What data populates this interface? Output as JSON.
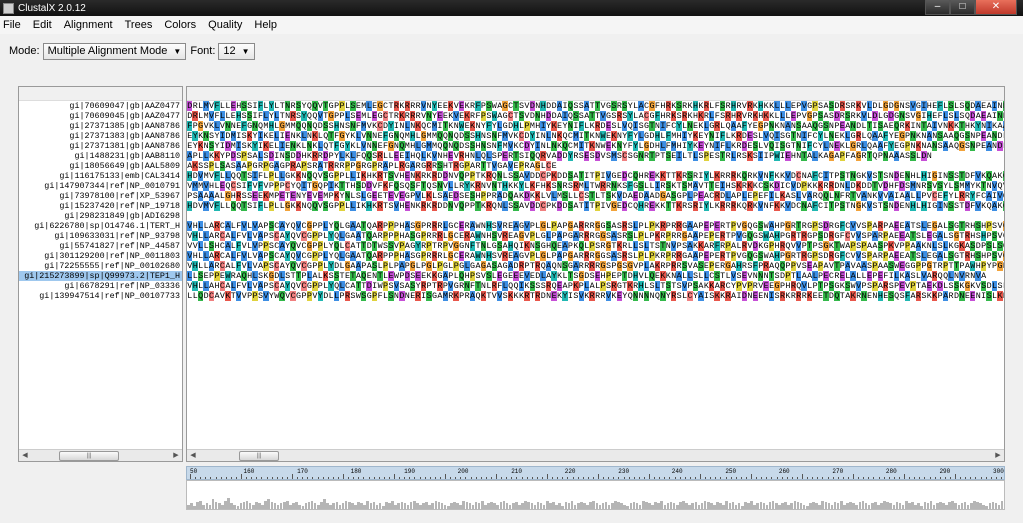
{
  "window": {
    "title": "ClustalX 2.0.12"
  },
  "menu": [
    "File",
    "Edit",
    "Alignment",
    "Trees",
    "Colors",
    "Quality",
    "Help"
  ],
  "mode": {
    "label": "Mode:",
    "value": "Multiple Alignment Mode",
    "font_label": "Font:",
    "font_value": "12"
  },
  "names": [
    "gi|70609047|gb|AAZ0477",
    "gi|70609045|gb|AAZ0477",
    "gi|27371385|gb|AAN8786",
    "gi|27371383|gb|AAN8786",
    "gi|27371381|gb|AAN8786",
    "gi|1488231|gb|AAB8110",
    "gi|18056649|gb|AAL5809",
    "gi|116175133|emb|CAL3414",
    "gi|147907344|ref|NP_0010791",
    "gi|73978100|ref|XP_53967",
    "gi|15237420|ref|NP_19718",
    "gi|298231849|gb|ADI6298",
    "gi|6226780|sp|O14746.1|TERT_H",
    "gi|109633031|ref|NP_93798",
    "gi|55741827|ref|NP_44587",
    "gi|301129200|ref|NP_0011803",
    "gi|72255555|ref|NP_00102680",
    "gi|215273899|sp|Q99973.2|TEP1_H",
    "gi|6678291|ref|NP_03336",
    "gi|139947514|ref|NP_00107733"
  ],
  "selected_index": 17,
  "sequences": [
    "DRLMVFLLEHSSIFLYLTNRSYQQVTGPPLSEMLEGCTRKRRRVNYEEKVEKRFPSWAGCTSVDNHDDAIQSSATTVGSRSYLACGFHRKSRKHKRLFSRHRVRKHKKLLLEPVGPSASDRSRKVLDLGDGNSVGIHEFLSLSQDAEAINNEKSCSN",
    "DRLMVFLLEHSSIFLYLTNRSYQQVTGPPLSEMLEGCTRKRRRVNYEEKVEKRFPSWAGCTSVDNHDDAIQSSATTVGSRSYLACGFHRKSRKHKRLFSRHRVRKHKKLLLEPVGPSASDRSRKVLDLGDGNSVGIHEFLSLSQDAEAINNEKSCSN",
    "FPGVKLVNNEFGNQMHLGMMQQNQDSSHNSNFMVKCDYINLNKQCMITKNWEKNYFYLGDHLPMHIYKEYNIFLKRDESLVQISGTNIFCYLNEKLGRLQAAFYEGPNKNANSAAQGSNPEANDLTISAEQRKINTAIVNKKTHKYNIKAADESY",
    "EYKNSYIDMISKYIKELIENKLNKLQTFGYKLVNNEFGNQMHLGMMQQNQDSSHNSNFMVKCDYINLNKQCMITKNWEKNYFYLGDHLFMHIYKEYNIFLKRDESLVQISGTNIFCYLNEKLGRLQAAFYEGPNKNANSAAQGSNPEANDLLS",
    "EYKNSYIDMISKYIKELIENKLNKLQTFGYKLVNNEFGNQMHLGMMQQNQDSSHNSNFMVKCDYINLNKQCMITKNWEKNYFYLGDHLFMHIYKEYNIFLKRDESLVQISGTNIFCYLNEKLGRLQAAFYEGPNKNANSAAQGSNPEANDLLS",
    "APLLKKYPDSPSALSDINSDDHKRRDPYLKLFQQSRLLEEIHQLKVNHEVRHNLQLSPERTSIQQRVADDYRSESDVSMSCSGNRTPTSEILTLSPESTRLRSKSIIPWIEHNTALKAGAPFAGRTQPNAAASSLDN",
    "AKSSPLSASAAPGRPGAGPRAPSRATRRRPPGRGPRAPLRGARGRRSHTRGPARTTVGAVEPRAGLCE",
    "HDVMVFLLQQTSIFLPLLGKKNQQVSGPPLLIKHKRTSVHENKRKRDDNVQPPTKRQNLSSAVDDCPKDDSATITPIVGEDCQHREKKTTKRSRIYLKRRRKQRKVNFKKVDCNAFCITPSTNGKVSTSNDENHLHIGINSSTDFVKQAKQR",
    "VMMVHLEQCSIFVFVPPPCYQITGQPIKTTHSDDVFKFQSQSFTQSNVLLRYKRNVNTHKKYLKFHKSNRSRMLTWRRNKSFGSLLIRSKTSMAVTTEIHSKRKKCSKDICVDPKKKRRDNLDKDDTVDHFDSMNRSVSYLSMMYKTNVQVK",
    "PSAAAALGHRSSEEKMPETENYEVEMPKYNLSLGEETEVEGPVLKLSAEDSESHPPRADQAKDKKLVLMSLLCSTLTSKVDAEDAADGASGPLPEACRDLAPLEPEFILKASLVARQQLNFRTVANKVVAIAALLPVCEFYLRRYFCAIVQLPS",
    "HDVMVFLLQQTSIFLPLLGKKNQQVSGPPLLIKHKRTSVHENKRKRDDNVQPPTKRQNLSSAVDDCPKDDSATITPIVGEDCQHREKKTTKRSRIYLKRRRKQRKVNFKKVDCNAFCITPSTNGKVSTSNDENHLHIGINSSTDFVKQAKQR",
    "",
    "VHLLARCALFVLVAPSCAYQVCGPPLYQLGAATQARPPPHASGPRRRLGCERAWNHSVREAGVPLGLPAPGARRRGGSASRSLPLPKRPRRGAAPEPERTPVGQGSWAHPGRTRGPSDRGFCVVSPARPAEEATSLEGALSGTRHSHPSVGRQHHA",
    "VHLLARCALFVLVAPSCAYQVCGPPLYQLGAATQARPPPHASGPRRRLGCERAWNHSVREAGVPLGLPAPGARRRGGSASRSLPLPKRPRRGAAPEPERTPVGQGSWAHPGRTRGPSDRGFCVVSPARPAEEATSLEGALSGTRHSHPSVGRQHHA",
    "VVLLSHCALFVLVPPSCAYQVCGPPLYQLCATTDTWSSVPAGYRPTRPVGGNFTNLGSAHQIKNSGHQEAPKQLPSRGTKRLLSLTSTNVPSAKKARFRPALRVDKGPHRQVVPTPSGKTWAPSPAASPKVPPAAKNLSLKGKASDPSLSGSVC",
    "VHLLARCALFVLVAPSCAYQVCGPPLYQLGAATQARPPPHASGPRRRLGCERAWNHSVREAGVPLGLPAPGARRRGGSASRSLPLPKRPRRGAAPEPERTPVGQGSWAHPGRTRGPSDRGFCVVSPARPAEEATSLEGALSGTRHSHPSVGRQHHA",
    "VHLLARCALFVLVAPSCAYQVCGPPLYDLGAAPASLPLPAPGLPGLPGLPGLGAGASAGADRPTRQAQNSGARRRRGSPGSGVPLAKRPRRSVASEPERGAHRSFPRAQQPPVSEAPAVTPAVAASPAASWEGGPPGTRPTTPAWHPYPGPQGVPH",
    "LLSEPPEWRAQHLSKGDLSTTPLALKSSTETAQENTLEWPDSEEKKGAPLQHPSVSLEGEEEVEDLAYKLTSGDSEHPEPTDHVLQEKKNALLSLLCSTLVSEVNNNTSDPTLAALPECRELALLEPEFILKASLVARQQLNVRNVA",
    "VHLLAHCALFVLVAPSCAYQVCGPPLYQLCATTDIWPSVSASYRPTRPVGRNFTNLRFLQQIKSSSRQEAPKPLALPSRGTKRHLSLTSTSVPSAKKARCYPVPRVEEGPHRQVLPTPSGKSWVPSPARSPEVPTAEKDLSSKGKVSDLSLSGSVC",
    "LLQDCAVKTVVPPSVYWQVCGPPVYDLLPRSWSGPFLSNDNERISGAMRKPRAQKTVVSKKKRTRDNEKYISVKRRRVKEYQNNNNQNYRSLCYAISKKRAIDNEENISRKRRRKEETDQTAKRNENHESQSFARSKKPARDNEENISLKRQ"
  ],
  "colors": {
    "hydrophobic": "#3d8ee3",
    "positive": "#e8564a",
    "negative": "#c64fd6",
    "polar": "#33b84a",
    "cysteine": "#f08080",
    "glycine": "#f2a33a",
    "proline": "#e0d23d",
    "aromatic": "#20b7b2",
    "selection": "#9fc8ee"
  },
  "ruler": {
    "labels": [
      "50",
      "160",
      "170",
      "180",
      "190",
      "200",
      "210",
      "220",
      "230",
      "240",
      "250",
      "260",
      "270",
      "280",
      "290",
      "300"
    ]
  },
  "quality": [
    3,
    4,
    2,
    5,
    6,
    3,
    4,
    3,
    7,
    5,
    4,
    3,
    6,
    8,
    4,
    3,
    2,
    4,
    5,
    6,
    4,
    3,
    5,
    4,
    3,
    6,
    7,
    5,
    4,
    3,
    4,
    5,
    6,
    3,
    4,
    5,
    3,
    2,
    4,
    5,
    6,
    4,
    3,
    5,
    7,
    4,
    3,
    4,
    5,
    3,
    4,
    6,
    5,
    4,
    3,
    5,
    4,
    3,
    6,
    4,
    5,
    3,
    4,
    2,
    5,
    4,
    6,
    3,
    4,
    5,
    4,
    3,
    5,
    6,
    4,
    3,
    4,
    5,
    3,
    4,
    6,
    5,
    4,
    3,
    2,
    4,
    5,
    4,
    3,
    6,
    5,
    4,
    3,
    5,
    4,
    6,
    3,
    4,
    5,
    4,
    3,
    5,
    6,
    4,
    3,
    4,
    5,
    3,
    4,
    6,
    5,
    4,
    3,
    5,
    4,
    3,
    6,
    4,
    5,
    3,
    4,
    2,
    5,
    4,
    6,
    3,
    4,
    5,
    4,
    3,
    5,
    6,
    4,
    3,
    4,
    5,
    3,
    4,
    6,
    5,
    4,
    3,
    2,
    4,
    5,
    4,
    3,
    6,
    5,
    4,
    3,
    5,
    4,
    6,
    3,
    4,
    5,
    4,
    3,
    5,
    6,
    4,
    3,
    4,
    5,
    3,
    4,
    6,
    5,
    4,
    3,
    5,
    4,
    3,
    6,
    4,
    5,
    3,
    4,
    2,
    5,
    4,
    6,
    3,
    4,
    5,
    4,
    3,
    5,
    6,
    4,
    3,
    4,
    5,
    3,
    4,
    6,
    5,
    4,
    3,
    2,
    4,
    5,
    4,
    3,
    6,
    5,
    4,
    3,
    5,
    4,
    6,
    3,
    4,
    5,
    4,
    3,
    5,
    6,
    4,
    3,
    4,
    5,
    3,
    4,
    6,
    5,
    4,
    3,
    5,
    4,
    3,
    6,
    4,
    5,
    3,
    4,
    2,
    5,
    4,
    6,
    3,
    4,
    5,
    4,
    3,
    5,
    6,
    4,
    3,
    4,
    5,
    3,
    4,
    6,
    5,
    4,
    3,
    2,
    4,
    5,
    4,
    3,
    6
  ]
}
